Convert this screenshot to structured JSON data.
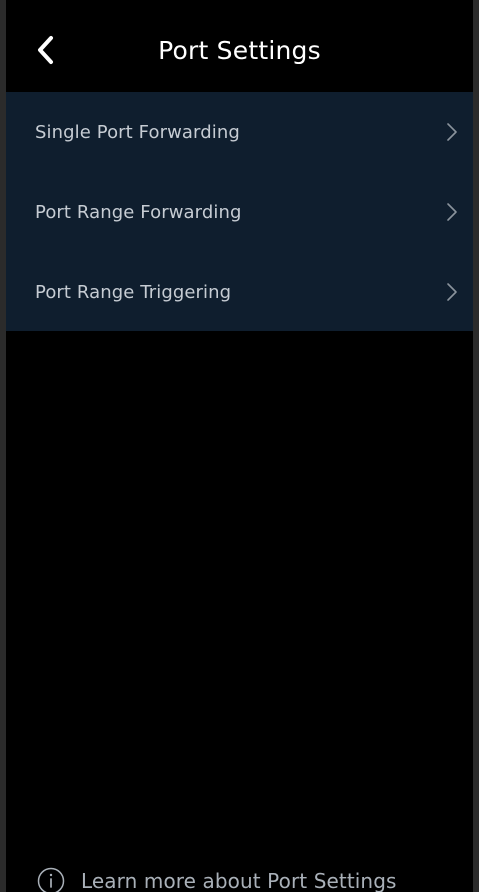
{
  "header": {
    "title": "Port Settings",
    "back_icon": "chevron-left-icon"
  },
  "menu": {
    "items": [
      {
        "label": "Single Port Forwarding",
        "icon": "chevron-right-icon"
      },
      {
        "label": "Port Range Forwarding",
        "icon": "chevron-right-icon"
      },
      {
        "label": "Port Range Triggering",
        "icon": "chevron-right-icon"
      }
    ]
  },
  "footer": {
    "learn_more_label": "Learn more about Port Settings",
    "icon": "info-icon"
  },
  "colors": {
    "background": "#000000",
    "panel": "#0f1e2e",
    "item_text": "#c6ccd3",
    "footer_text": "#a9b0b8",
    "title_text": "#ffffff"
  }
}
